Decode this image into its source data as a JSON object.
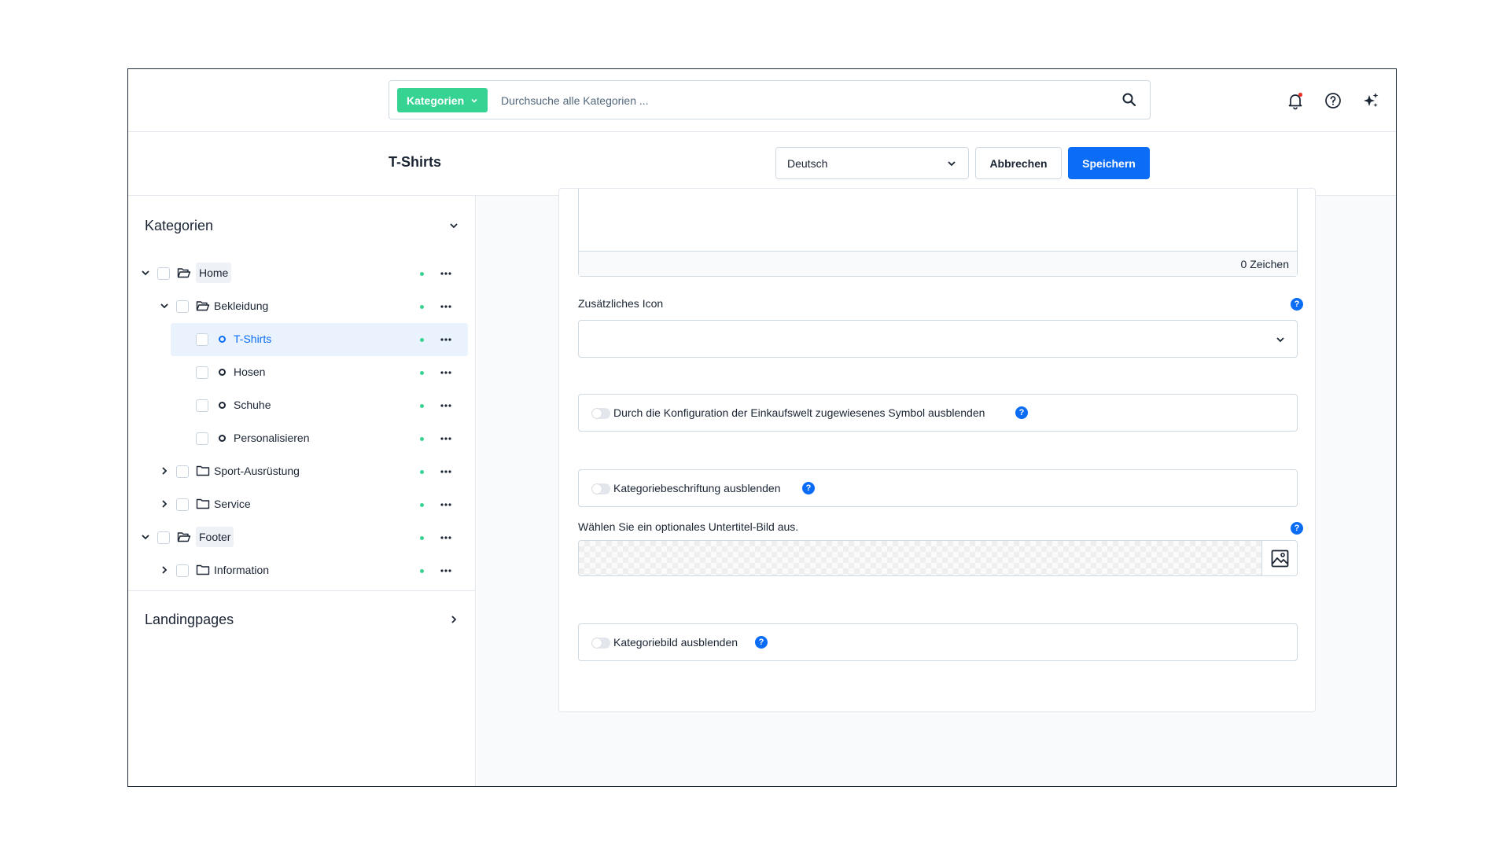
{
  "search": {
    "type_label": "Kategorien",
    "placeholder": "Durchsuche alle Kategorien ..."
  },
  "header": {
    "notification_badge_color": "#e5322d"
  },
  "actionbar": {
    "title": "T-Shirts",
    "language": "Deutsch",
    "cancel_label": "Abbrechen",
    "save_label": "Speichern"
  },
  "sidebar": {
    "categories_title": "Kategorien",
    "landingpages_title": "Landingpages",
    "tree": [
      {
        "label": "Home",
        "level": 0,
        "expanded": true,
        "folder": "open"
      },
      {
        "label": "Bekleidung",
        "level": 1,
        "expanded": true,
        "folder": "open"
      },
      {
        "label": "T-Shirts",
        "level": 2,
        "selected": true,
        "leaf": true
      },
      {
        "label": "Hosen",
        "level": 2,
        "leaf": true
      },
      {
        "label": "Schuhe",
        "level": 2,
        "leaf": true
      },
      {
        "label": "Personalisieren",
        "level": 2,
        "leaf": true
      },
      {
        "label": "Sport-Ausrüstung",
        "level": 1,
        "expanded": false,
        "folder": "closed"
      },
      {
        "label": "Service",
        "level": 1,
        "expanded": false,
        "folder": "closed"
      },
      {
        "label": "Footer",
        "level": 0,
        "expanded": true,
        "folder": "open"
      },
      {
        "label": "Information",
        "level": 1,
        "expanded": false,
        "folder": "closed"
      }
    ]
  },
  "form": {
    "char_count": "0 Zeichen",
    "icon_label": "Zusätzliches Icon",
    "hide_symbol_label": "Durch die Konfiguration der Einkaufswelt zugewiesenes Symbol ausblenden",
    "hide_caption_label": "Kategoriebeschriftung ausblenden",
    "subtitle_image_label": "Wählen Sie ein optionales Untertitel-Bild aus.",
    "hide_image_label": "Kategoriebild ausblenden",
    "help_glyph": "?"
  },
  "colors": {
    "accent": "#0b6cf5",
    "search_type": "#37d393",
    "status_active": "#37d393"
  }
}
